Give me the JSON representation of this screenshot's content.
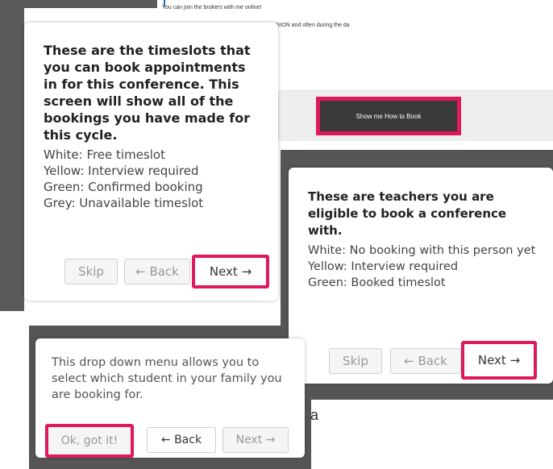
{
  "background": {
    "line1": "You can join the brokers with me online!",
    "line2": "UR HANDS BEFORE AND AFTER OUR SESSION and often during the da",
    "show_me_button": "Show me How to Book",
    "partial_letter": "a"
  },
  "tooltip_timeslots": {
    "title": "These are the timeslots that you can book appointments in for this conference. This screen will show all of the bookings you have made for this cycle.",
    "legend": [
      "White: Free timeslot",
      "Yellow: Interview required",
      "Green: Confirmed booking",
      "Grey: Unavailable timeslot"
    ],
    "skip": "Skip",
    "back": "← Back",
    "next": "Next →"
  },
  "tooltip_teachers": {
    "title": "These are teachers you are eligible to book a conference with.",
    "legend": [
      "White: No booking with this person yet",
      "Yellow: Interview required",
      "Green: Booked timeslot"
    ],
    "skip": "Skip",
    "back": "← Back",
    "next": "Next →"
  },
  "tooltip_dropdown": {
    "text": "This drop down menu allows you to select which student in your family you are booking for.",
    "ok": "Ok, got it!",
    "back": "← Back",
    "next": "Next →"
  },
  "colors": {
    "highlight": "#e0195a",
    "dark_button": "#3a3a3a"
  }
}
